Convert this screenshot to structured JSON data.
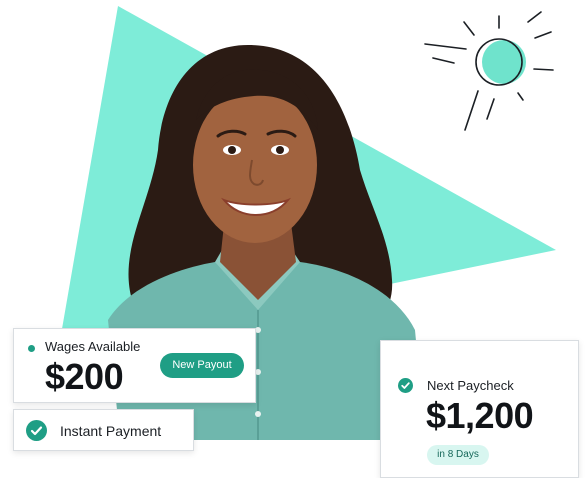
{
  "colors": {
    "accent": "#1f9e85",
    "mint_shape": "#7eecd8",
    "pill_bg": "#d8f6f0",
    "text_dark": "#111418"
  },
  "hero": {
    "icon": "sun-icon"
  },
  "wages_card": {
    "label": "Wages Available",
    "amount": "$200",
    "button_label": "New Payout"
  },
  "instant_card": {
    "label": "Instant Payment",
    "icon": "check-circle-icon"
  },
  "paycheck_card": {
    "label": "Next Paycheck",
    "amount": "$1,200",
    "days_label": "in 8 Days",
    "icon": "check-circle-icon"
  }
}
